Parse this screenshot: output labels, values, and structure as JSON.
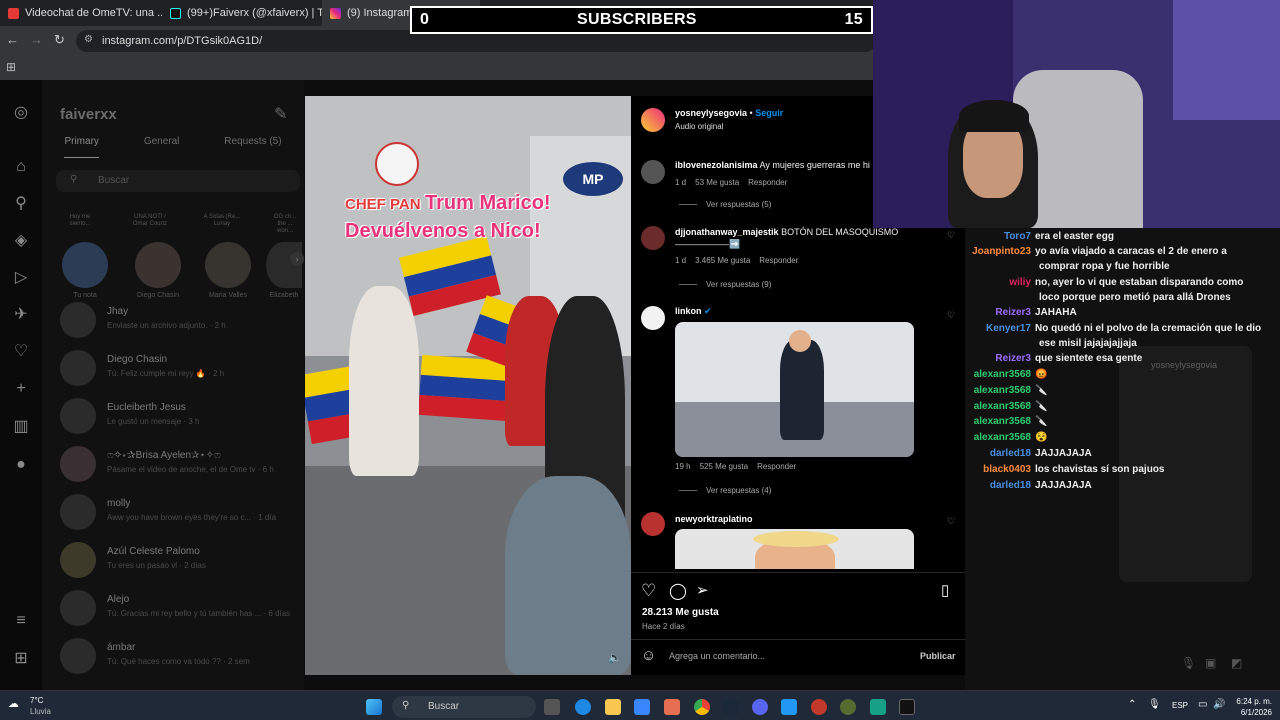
{
  "browser": {
    "tabs": [
      {
        "title": "Videochat de OmeTV: una ..."
      },
      {
        "title": "(99+)Faiverx (@xfaiverx) | TikTo..."
      },
      {
        "title": "(9) Instagram • Mensajes"
      }
    ],
    "url": "instagram.com/p/DTGsik0AG1D/"
  },
  "overlay": {
    "sub_left": "0",
    "sub_title": "SUBSCRIBERS",
    "sub_right": "15"
  },
  "dm": {
    "username": "faiverxx",
    "tabs": [
      "Primary",
      "General",
      "Requests (5)"
    ],
    "search_placeholder": "Buscar",
    "notes": [
      {
        "text": "Hoy me siento..."
      },
      {
        "text": "UNA NOTI / Omar Courtz"
      },
      {
        "text": "A Solas (Re... Lunay"
      },
      {
        "text": "GG ch... the ... won..."
      }
    ],
    "stories": [
      "Tu nota",
      "Diego Chasin",
      "Maria Valles",
      "Elizabeth"
    ],
    "conversations": [
      {
        "name": "Jhay",
        "preview": "Enviaste un archivo adjunto. · 2 h"
      },
      {
        "name": "Diego Chasin",
        "preview": "Tú: Feliz cumple mi reyy 🔥 · 2 h"
      },
      {
        "name": "Eucleiberth Jesus",
        "preview": "Le gustó un mensaje · 3 h"
      },
      {
        "name": "ෆ✧⋆✰Brisa Ayelen✰⋆✧ෆ",
        "preview": "Pásame el video de anoche, el de Ome tv · 6 h"
      },
      {
        "name": "molly",
        "preview": "Aww you have brown eyes they're so c... · 1 día"
      },
      {
        "name": "Azúl Celeste Palomo",
        "preview": "Tu eres un pasao vl · 2 días"
      },
      {
        "name": "Alejo",
        "preview": "Tú: Gracias mi rey bello y tú también has ... · 6 días"
      },
      {
        "name": "ámbar",
        "preview": "Tú: Qué haces como va todo ?? · 2 sem"
      }
    ]
  },
  "video": {
    "caption_line1": "Trum Marico!",
    "caption_line2": "Devuélvenos a Nico!",
    "sign_text": "CHEF PAN",
    "sign_logo": "MP"
  },
  "post": {
    "author": "yosneylysegovia",
    "follow": "Seguir",
    "audio": "Audio original",
    "comments": [
      {
        "user": "iblovenezolanisima",
        "text": "Ay mujeres guerreras me hi",
        "time": "1 d",
        "likes": "53 Me gusta",
        "reply": "Responder",
        "replies": "Ver respuestas (5)"
      },
      {
        "user": "djjonathanway_majestik",
        "text": "BOTÓN DEL MASOQUISMO ——————➡️",
        "time": "1 d",
        "likes": "3.465 Me gusta",
        "reply": "Responder",
        "replies": "Ver respuestas (9)"
      },
      {
        "user": "linkon",
        "text": "",
        "time": "19 h",
        "likes": "525 Me gusta",
        "reply": "Responder",
        "replies": "Ver respuestas (4)"
      },
      {
        "user": "newyorktraplatino",
        "text": ""
      }
    ],
    "total_likes": "28.213 Me gusta",
    "posted": "Hace 2 días",
    "comment_placeholder": "Agrega un comentario...",
    "publish": "Publicar"
  },
  "chat": {
    "lines": [
      {
        "user": "Toro7",
        "color": "#4a90e2",
        "msg": "era el easter egg"
      },
      {
        "user": "Joanpinto23",
        "color": "#ff8a3d",
        "msg": "yo avía viajado a caracas el 2 de enero a comprar ropa y fue horrible"
      },
      {
        "user": "wiliy",
        "color": "#e0245e",
        "msg": "no, ayer lo vi que estaban disparando como loco porque pero metió para allá Drones"
      },
      {
        "user": "Reizer3",
        "color": "#9b6dff",
        "msg": "JAHAHA"
      },
      {
        "user": "Kenyer17",
        "color": "#4a90e2",
        "msg": "No quedó ni el polvo de la cremación que le dio ese misil jajajajajjaja"
      },
      {
        "user": "Reizer3",
        "color": "#9b6dff",
        "msg": "que sientete esa gente"
      },
      {
        "user": "alexanr3568",
        "color": "#2ecc71",
        "msg": "😡"
      },
      {
        "user": "alexanr3568",
        "color": "#2ecc71",
        "msg": "🔪"
      },
      {
        "user": "alexanr3568",
        "color": "#2ecc71",
        "msg": "🔪"
      },
      {
        "user": "alexanr3568",
        "color": "#2ecc71",
        "msg": "🔪"
      },
      {
        "user": "alexanr3568",
        "color": "#2ecc71",
        "msg": "😵"
      },
      {
        "user": "darled18",
        "color": "#4a90e2",
        "msg": "JAJJAJAJA"
      },
      {
        "user": "black0403",
        "color": "#ff8a3d",
        "msg": "los chavistas sí son pajuos"
      },
      {
        "user": "darled18",
        "color": "#4a90e2",
        "msg": "JAJJAJAJA"
      }
    ],
    "ghost_name": "yosneylysegovia"
  },
  "taskbar": {
    "weather_temp": "7°C",
    "weather_desc": "Lluvia",
    "search": "Buscar",
    "lang": "ESP",
    "time": "6:24 p. m.",
    "date": "6/1/2026"
  },
  "colors": {
    "accent": "#0095f6",
    "ig_bg": "#000000",
    "chat_bg": "#111111"
  }
}
